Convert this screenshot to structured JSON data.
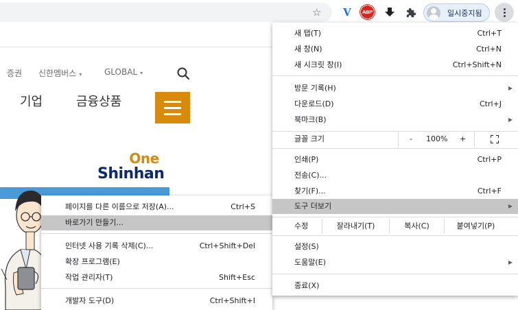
{
  "browser": {
    "profile_label": "일시중지됨",
    "extensions": [
      "v-extension-icon",
      "adblock-plus-icon",
      "download-icon",
      "puzzle-icon"
    ],
    "abp_text": "ABP"
  },
  "webpage": {
    "gnb_links": [
      {
        "label": "증권",
        "has_caret": false
      },
      {
        "label": "신한멤버스",
        "has_caret": true
      },
      {
        "label": "GLOBAL",
        "has_caret": true
      }
    ],
    "caret": "▾",
    "top_menu": [
      "기업",
      "금융상품"
    ],
    "logo": {
      "one": "One",
      "main": "Shinhan"
    },
    "accent_color": "#d88a0b",
    "brand_color": "#0d2a6e"
  },
  "chrome_menu": {
    "items": [
      {
        "label": "새 탭(T)",
        "shortcut": "Ctrl+T"
      },
      {
        "label": "새 창(N)",
        "shortcut": "Ctrl+N"
      },
      {
        "label": "새 시크릿 창(I)",
        "shortcut": "Ctrl+Shift+N"
      },
      {
        "label": "방문 기록(H)",
        "shortcut": ""
      },
      {
        "label": "다운로드(D)",
        "shortcut": "Ctrl+J"
      },
      {
        "label": "북마크(B)",
        "shortcut": ""
      },
      {
        "label": "인쇄(P)",
        "shortcut": "Ctrl+P"
      },
      {
        "label": "전송(C)...",
        "shortcut": ""
      },
      {
        "label": "찾기(F)...",
        "shortcut": "Ctrl+F"
      },
      {
        "label": "도구 더보기",
        "shortcut": ""
      },
      {
        "label": "설정(S)",
        "shortcut": ""
      },
      {
        "label": "도움말(E)",
        "shortcut": ""
      },
      {
        "label": "종료(X)",
        "shortcut": ""
      }
    ],
    "zoom": {
      "label": "글꼴 크기",
      "minus": "-",
      "value": "100%",
      "plus": "+"
    },
    "edit": {
      "label": "수정",
      "cut": "잘라내기(T)",
      "copy": "복사(C)",
      "paste": "붙여넣기(P)"
    },
    "submenu_arrow": "▶"
  },
  "tools_submenu": {
    "items": [
      {
        "label": "페이지를 다른 이름으로 저장(A)...",
        "shortcut": "Ctrl+S"
      },
      {
        "label": "바로가기 만들기...",
        "shortcut": ""
      },
      {
        "label": "인터넷 사용 기록 삭제(C)...",
        "shortcut": "Ctrl+Shift+Del"
      },
      {
        "label": "확장 프로그램(E)",
        "shortcut": ""
      },
      {
        "label": "작업 관리자(T)",
        "shortcut": "Shift+Esc"
      },
      {
        "label": "개발자 도구(D)",
        "shortcut": "Ctrl+Shift+I"
      }
    ]
  }
}
